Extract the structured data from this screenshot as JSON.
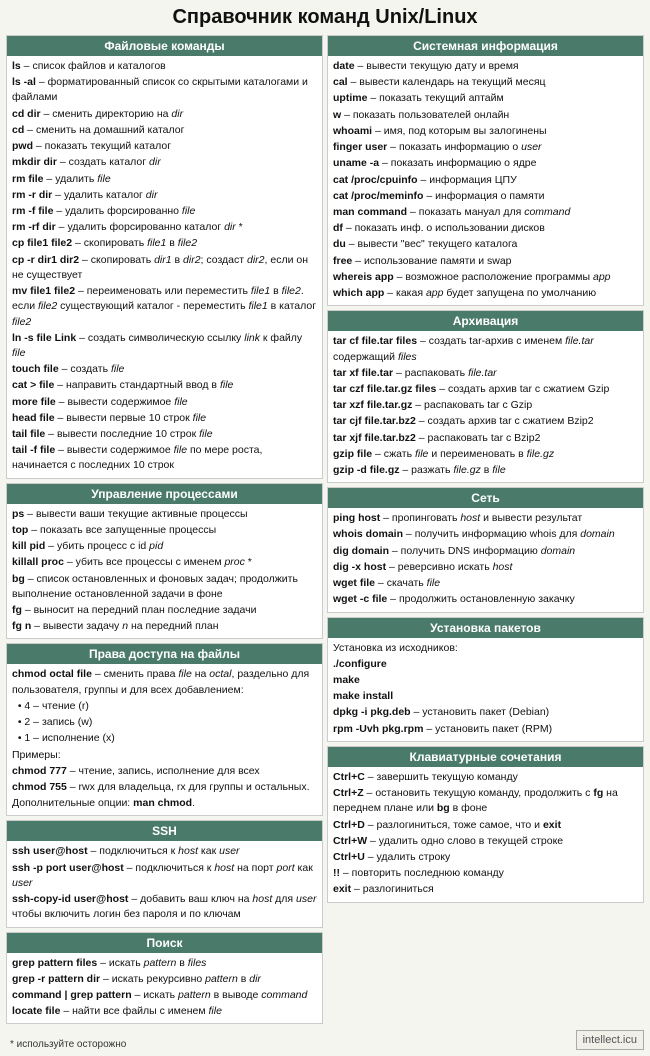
{
  "title": "Справочник команд Unix/Linux",
  "sections": {
    "file_commands": {
      "title": "Файловые команды",
      "items": [
        "<b>ls</b> – список файлов и каталогов",
        "<b>ls -al</b> – форматированный список со скрытыми каталогами и файлами",
        "<b>cd dir</b> – сменить директорию на <i>dir</i>",
        "<b>cd</b> – сменить на домашний каталог",
        "<b>pwd</b> – показать текущий каталог",
        "<b>mkdir dir</b> – создать каталог <i>dir</i>",
        "<b>rm file</b> – удалить <i>file</i>",
        "<b>rm -r dir</b> – удалить каталог <i>dir</i>",
        "<b>rm -f file</b> – удалить форсированно <i>file</i>",
        "<b>rm -rf dir</b> – удалить форсированно каталог <i>dir</i> *",
        "<b>cp file1 file2</b> – скопировать <i>file1</i> в <i>file2</i>",
        "<b>cp -r dir1 dir2</b> – скопировать <i>dir1</i> в <i>dir2</i>; создаст <i>dir2</i>, если он не существует",
        "<b>mv file1 file2</b> – переименовать или переместить <i>file1</i> в <i>file2</i>. если <i>file2</i> существующий каталог - переместить <i>file1</i> в каталог <i>file2</i>",
        "<b>ln -s file Link</b> – создать символическую ссылку <i>link</i> к файлу <i>file</i>",
        "<b>touch file</b> – создать <i>file</i>",
        "<b>cat > file</b> – направить стандартный ввод в <i>file</i>",
        "<b>more file</b> – вывести содержимое <i>file</i>",
        "<b>head file</b> – вывести первые 10 строк <i>file</i>",
        "<b>tail file</b> – вывести последние 10 строк <i>file</i>",
        "<b>tail -f file</b> – вывести содержимое <i>file</i> по мере роста, начинается с последних 10 строк"
      ]
    },
    "process_management": {
      "title": "Управление процессами",
      "items": [
        "<b>ps</b> – вывести ваши текущие активные процессы",
        "<b>top</b> – показать все запущенные процессы",
        "<b>kill pid</b> – убить процесс с id <i>pid</i>",
        "<b>killall proc</b> – убить все процессы с именем <i>proc</i> *",
        "<b>bg</b> – список остановленных и фоновых задач; продолжить выполнение остановленной задачи в фоне",
        "<b>fg</b> – выносит на передний план последние задачи",
        "<b>fg n</b> – вывести задачу <i>n</i> на передний план"
      ]
    },
    "file_permissions": {
      "title": "Права доступа на файлы",
      "body": "<b>chmod octal file</b> – сменить права <i>file</i> на <i>octal</i>, раздельно для пользователя, группы и для всех добавлением:<br>• 4 – чтение (r)<br>• 2 – запись (w)<br>• 1 – исполнение (x)<br><br>Примеры:<br><b>chmod 777</b> – чтение, запись, исполнение для всех<br><b>chmod 755</b> – rwx для владельца, rx для группы и остальных.<br><br>Дополнительные опции: <b>man chmod</b>."
    },
    "ssh": {
      "title": "SSH",
      "items": [
        "<b>ssh user@host</b> – подключиться к <i>host</i> как <i>user</i>",
        "<b>ssh -p port user@host</b> – подключиться к <i>host</i> на порт <i>port</i> как <i>user</i>",
        "<b>ssh-copy-id user@host</b> – добавить ваш ключ на <i>host</i> для <i>user</i> чтобы включить логин без пароля и по ключам"
      ]
    },
    "search": {
      "title": "Поиск",
      "items": [
        "<b>grep pattern files</b> – искать <i>pattern</i> в <i>files</i>",
        "<b>grep -r pattern dir</b> – искать рекурсивно <i>pattern</i> в <i>dir</i>",
        "<b>command | grep pattern</b> – искать <i>pattern</i> в выводе <i>command</i>",
        "<b>locate file</b> – найти все файлы с именем <i>file</i>"
      ]
    },
    "system_info": {
      "title": "Системная информация",
      "items": [
        "<b>date</b> – вывести текущую дату и время",
        "<b>cal</b> – вывести календарь на текущий месяц",
        "<b>uptime</b> – показать текущий аптайм",
        "<b>w</b> – показать пользователей онлайн",
        "<b>whoami</b> – имя, под которым вы залогинены",
        "<b>finger user</b> – показать информацию о <i>user</i>",
        "<b>uname -a</b> – показать информацию о ядре",
        "<b>cat /proc/cpuinfo</b> – информация ЦПУ",
        "<b>cat /proc/meminfo</b> – информация о памяти",
        "<b>man command</b> – показать мануал для <i>command</i>",
        "<b>df</b> – показать инф. о использовании дисков",
        "<b>du</b> – вывести \"вес\" текущего каталога",
        "<b>free</b> – использование памяти и swap",
        "<b>whereis app</b> – возможное расположение программы <i>app</i>",
        "<b>which app</b> – какая <i>app</i> будет запущена по умолчанию"
      ]
    },
    "archiving": {
      "title": "Архивация",
      "items": [
        "<b>tar cf file.tar files</b> – создать tar-архив с именем <i>file.tar</i> содержащий <i>files</i>",
        "<b>tar xf file.tar</b> – распаковать <i>file.tar</i>",
        "<b>tar czf file.tar.gz files</b> – создать архив tar с сжатием Gzip",
        "<b>tar xzf file.tar.gz</b> – распаковать tar с Gzip",
        "<b>tar cjf file.tar.bz2</b> – создать архив tar с сжатием Bzip2",
        "<b>tar xjf file.tar.bz2</b> – распаковать tar с Bzip2",
        "<b>gzip file</b> – сжать <i>file</i> и переименовать в <i>file.gz</i>",
        "<b>gzip -d file.gz</b> – разжать <i>file.gz</i> в <i>file</i>"
      ]
    },
    "network": {
      "title": "Сеть",
      "items": [
        "<b>ping host</b> – пропинговать <i>host</i> и вывести результат",
        "<b>whois domain</b> – получить информацию whois для <i>domain</i>",
        "<b>dig domain</b> – получить DNS информацию <i>domain</i>",
        "<b>dig -x host</b> – реверсивно искать <i>host</i>",
        "<b>wget file</b> – скачать <i>file</i>",
        "<b>wget -c file</b> – продолжить остановленную закачку"
      ]
    },
    "package_install": {
      "title": "Установка пакетов",
      "body": "Установка из исходников:<br><b>./configure</b><br><b>make</b><br><b>make install</b><br><br><b>dpkg -i pkg.deb</b> – установить пакет (Debian)<br><b>rpm -Uvh pkg.rpm</b> – установить пакет (RPM)"
    },
    "keyboard_shortcuts": {
      "title": "Клавиатурные сочетания",
      "items": [
        "<b>Ctrl+C</b> – завершить текущую команду",
        "<b>Ctrl+Z</b> – остановить текущую команду, продолжить с <b>fg</b> на переднем плане или <b>bg</b> в фоне",
        "<b>Ctrl+D</b> – разлогиниться, тоже самое, что и <b>exit</b>",
        "<b>Ctrl+W</b> – удалить одно слово в текущей строке",
        "<b>Ctrl+U</b> – удалить строку",
        "<b>!!</b> – повторить последнюю команду",
        "<b>exit</b> – разлогиниться"
      ]
    }
  },
  "footer": {
    "asterisk_note": "* используйте осторожно",
    "watermark": "intellect.icu"
  }
}
